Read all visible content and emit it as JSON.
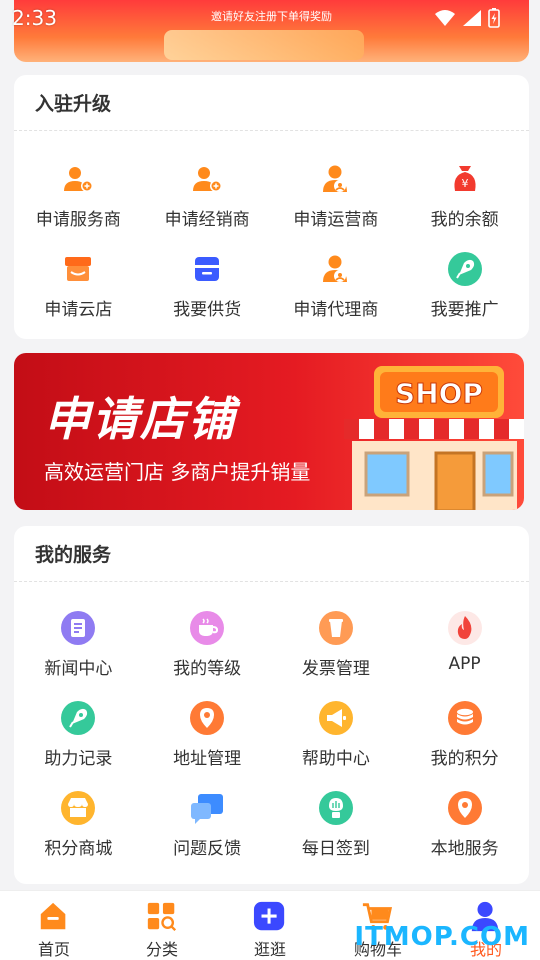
{
  "status_bar": {
    "time": "2:33"
  },
  "top_banner": {
    "text": "邀请好友注册下单得奖励"
  },
  "upgrade": {
    "title": "入驻升级",
    "items": [
      {
        "label": "申请服务商",
        "icon": "user-plus-icon",
        "color": "#ff8a1c"
      },
      {
        "label": "申请经销商",
        "icon": "user-plus-icon",
        "color": "#ff8a1c"
      },
      {
        "label": "申请运营商",
        "icon": "user-badge-icon",
        "color": "#ff8a1c"
      },
      {
        "label": "我的余额",
        "icon": "money-bag-icon",
        "color": "#f23a2e"
      },
      {
        "label": "申请云店",
        "icon": "store-icon",
        "color": "#ff6a1a"
      },
      {
        "label": "我要供货",
        "icon": "box-icon",
        "color": "#3b5bff"
      },
      {
        "label": "申请代理商",
        "icon": "user-badge-icon",
        "color": "#ff8a1c"
      },
      {
        "label": "我要推广",
        "icon": "rocket-icon",
        "color": "#35c99a"
      }
    ]
  },
  "shop_banner": {
    "title": "申请店铺",
    "subtitle": "高效运营门店 多商户提升销量",
    "sign": "SHOP"
  },
  "services": {
    "title": "我的服务",
    "items": [
      {
        "label": "新闻中心",
        "icon": "news-icon",
        "color": "#8f7bf2"
      },
      {
        "label": "我的等级",
        "icon": "cup-icon",
        "color": "#e88be8"
      },
      {
        "label": "发票管理",
        "icon": "invoice-icon",
        "color": "#ff9b55"
      },
      {
        "label": "APP",
        "icon": "flame-icon",
        "color": "#f1443b"
      },
      {
        "label": "助力记录",
        "icon": "rocket-icon",
        "color": "#35c99a"
      },
      {
        "label": "地址管理",
        "icon": "location-pin-icon",
        "color": "#ff7a35"
      },
      {
        "label": "帮助中心",
        "icon": "megaphone-icon",
        "color": "#ffb52e"
      },
      {
        "label": "我的积分",
        "icon": "coins-icon",
        "color": "#ff7a35"
      },
      {
        "label": "积分商城",
        "icon": "shop-icon",
        "color": "#ffb52e"
      },
      {
        "label": "问题反馈",
        "icon": "chat-icon",
        "color": "#3d8cff"
      },
      {
        "label": "每日签到",
        "icon": "checkin-icon",
        "color": "#35c99a"
      },
      {
        "label": "本地服务",
        "icon": "location-pin-icon",
        "color": "#ff7a35"
      }
    ]
  },
  "tabbar": {
    "items": [
      {
        "label": "首页",
        "icon": "home-icon",
        "color": "#ff8a1c"
      },
      {
        "label": "分类",
        "icon": "category-icon",
        "color": "#ff8a1c"
      },
      {
        "label": "逛逛",
        "icon": "plus-icon",
        "color": "#3b48ff"
      },
      {
        "label": "购物车",
        "icon": "cart-icon",
        "color": "#ff8a1c"
      },
      {
        "label": "我的",
        "icon": "user-icon",
        "color": "#3b48ff"
      }
    ],
    "active_index": 4
  },
  "watermark": "ITMOP.COM"
}
